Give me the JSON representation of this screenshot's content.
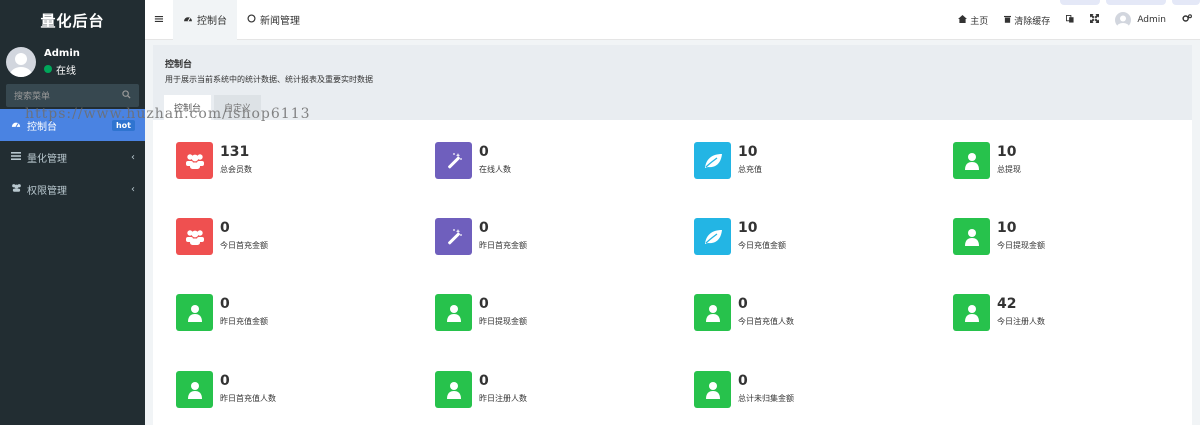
{
  "brand": "量化后台",
  "user": {
    "name": "Admin",
    "status": "在线"
  },
  "search": {
    "placeholder": "搜索菜单"
  },
  "menu": [
    {
      "label": "控制台",
      "badge": "hot",
      "icon": "dashboard-icon"
    },
    {
      "label": "量化管理",
      "icon": "list-icon"
    },
    {
      "label": "权限管理",
      "icon": "users-icon"
    }
  ],
  "tabs": [
    {
      "label": "控制台",
      "icon": "dashboard-icon"
    },
    {
      "label": "新闻管理",
      "icon": "circle-icon"
    }
  ],
  "header_right": {
    "home": "主页",
    "clear_cache": "清除缓存",
    "admin": "Admin"
  },
  "panel": {
    "title": "控制台",
    "description": "用于展示当前系统中的统计数据、统计报表及重要实时数据",
    "tabs": [
      "控制台",
      "自定义"
    ]
  },
  "watermark": "https://www.huzhan.com/ishop6113",
  "colors": {
    "red": "#ef5050",
    "purple": "#6f5fbd",
    "cyan": "#23b5e4",
    "green": "#27c24c",
    "sidebar": "#222d32",
    "accent": "#4a83e2"
  },
  "stats": [
    {
      "value": "131",
      "label": "总会员数",
      "color": "red",
      "icon": "users-icon"
    },
    {
      "value": "0",
      "label": "在线人数",
      "color": "purple",
      "icon": "magic-icon"
    },
    {
      "value": "10",
      "label": "总充值",
      "color": "cyan",
      "icon": "leaf-icon"
    },
    {
      "value": "10",
      "label": "总提现",
      "color": "green",
      "icon": "user-icon"
    },
    {
      "value": "0",
      "label": "今日首充金额",
      "color": "red",
      "icon": "users-icon"
    },
    {
      "value": "0",
      "label": "昨日首充金额",
      "color": "purple",
      "icon": "magic-icon"
    },
    {
      "value": "10",
      "label": "今日充值金额",
      "color": "cyan",
      "icon": "leaf-icon"
    },
    {
      "value": "10",
      "label": "今日提现金额",
      "color": "green",
      "icon": "user-icon"
    },
    {
      "value": "0",
      "label": "昨日充值金额",
      "color": "green",
      "icon": "user-icon"
    },
    {
      "value": "0",
      "label": "昨日提现金额",
      "color": "green",
      "icon": "user-icon"
    },
    {
      "value": "0",
      "label": "今日首充值人数",
      "color": "green",
      "icon": "user-icon"
    },
    {
      "value": "42",
      "label": "今日注册人数",
      "color": "green",
      "icon": "user-icon"
    },
    {
      "value": "0",
      "label": "昨日首充值人数",
      "color": "green",
      "icon": "user-icon"
    },
    {
      "value": "0",
      "label": "昨日注册人数",
      "color": "green",
      "icon": "user-icon"
    },
    {
      "value": "0",
      "label": "总计未归集金额",
      "color": "green",
      "icon": "user-icon"
    }
  ]
}
